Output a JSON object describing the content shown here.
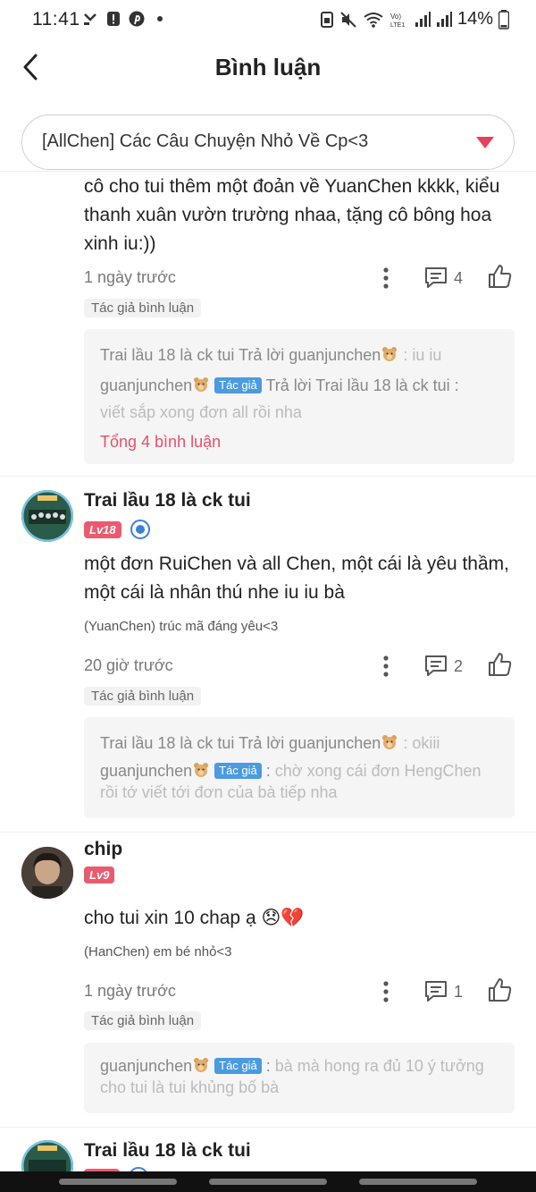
{
  "status_bar": {
    "time": "11:41",
    "battery": "14%"
  },
  "header": {
    "title": "Bình luận"
  },
  "story_selector": {
    "value": "[AllChen] Các Câu Chuyện Nhỏ Về Cp<3"
  },
  "colors": {
    "accent": "#e8405a",
    "author_pill": "#4a9be0",
    "level_badge": "#ec5a6e"
  },
  "comments": [
    {
      "body": "cô cho tui thêm một đoản về YuanChen kkkk, kiểu thanh xuân vườn trường nhaa, tặng cô bông hoa xinh iu:))",
      "time": "1 ngày trước",
      "reply_count": "4",
      "author_tag": "Tác giả bình luận",
      "replies": [
        {
          "prefix": "Trai lầu 18 là ck tui Trả lời guanjunchen",
          "suffix": " : iu iu"
        },
        {
          "name": "guanjunchen",
          "pill": "Tác giả",
          "prefix": " Trả lời Trai lầu 18 là ck tui :",
          "suffix": " viết sắp xong đơn all rồi nha"
        }
      ],
      "total": "Tổng 4 bình luận"
    },
    {
      "username": "Trai lầu 18 là ck tui",
      "level": "Lv18",
      "body": "một đơn RuiChen và all Chen, một cái là yêu thầm, một cái là nhân thú nhe iu iu bà",
      "tag": "(YuanChen) trúc mã đáng yêu<3",
      "time": "20 giờ trước",
      "reply_count": "2",
      "author_tag": "Tác giả bình luận",
      "replies": [
        {
          "prefix": "Trai lầu 18 là ck tui Trả lời guanjunchen",
          "suffix": " : okiii"
        },
        {
          "name": "guanjunchen",
          "pill": "Tác giả",
          "prefix": " :",
          "suffix": " chờ xong cái đơn HengChen rồi tớ viết tới đơn của bà tiếp nha"
        }
      ]
    },
    {
      "username": "chip",
      "level": "Lv9",
      "body": "cho tui xin 10 chap ạ 😞💔",
      "tag": "(HanChen) em bé nhỏ<3",
      "time": "1 ngày trước",
      "reply_count": "1",
      "author_tag": "Tác giả bình luận",
      "replies": [
        {
          "name": "guanjunchen",
          "pill": "Tác giả",
          "prefix": " :",
          "suffix": " bà mà hong ra đủ 10 ý tưởng cho tui là tui khủng bố bà"
        }
      ]
    },
    {
      "username": "Trai lầu 18 là ck tui"
    }
  ],
  "icons": [
    "back-arrow-icon",
    "caret-down-icon",
    "more-vertical-icon",
    "reply-bubble-icon",
    "thumbs-up-icon",
    "bear-emoji-icon",
    "verified-icon"
  ]
}
